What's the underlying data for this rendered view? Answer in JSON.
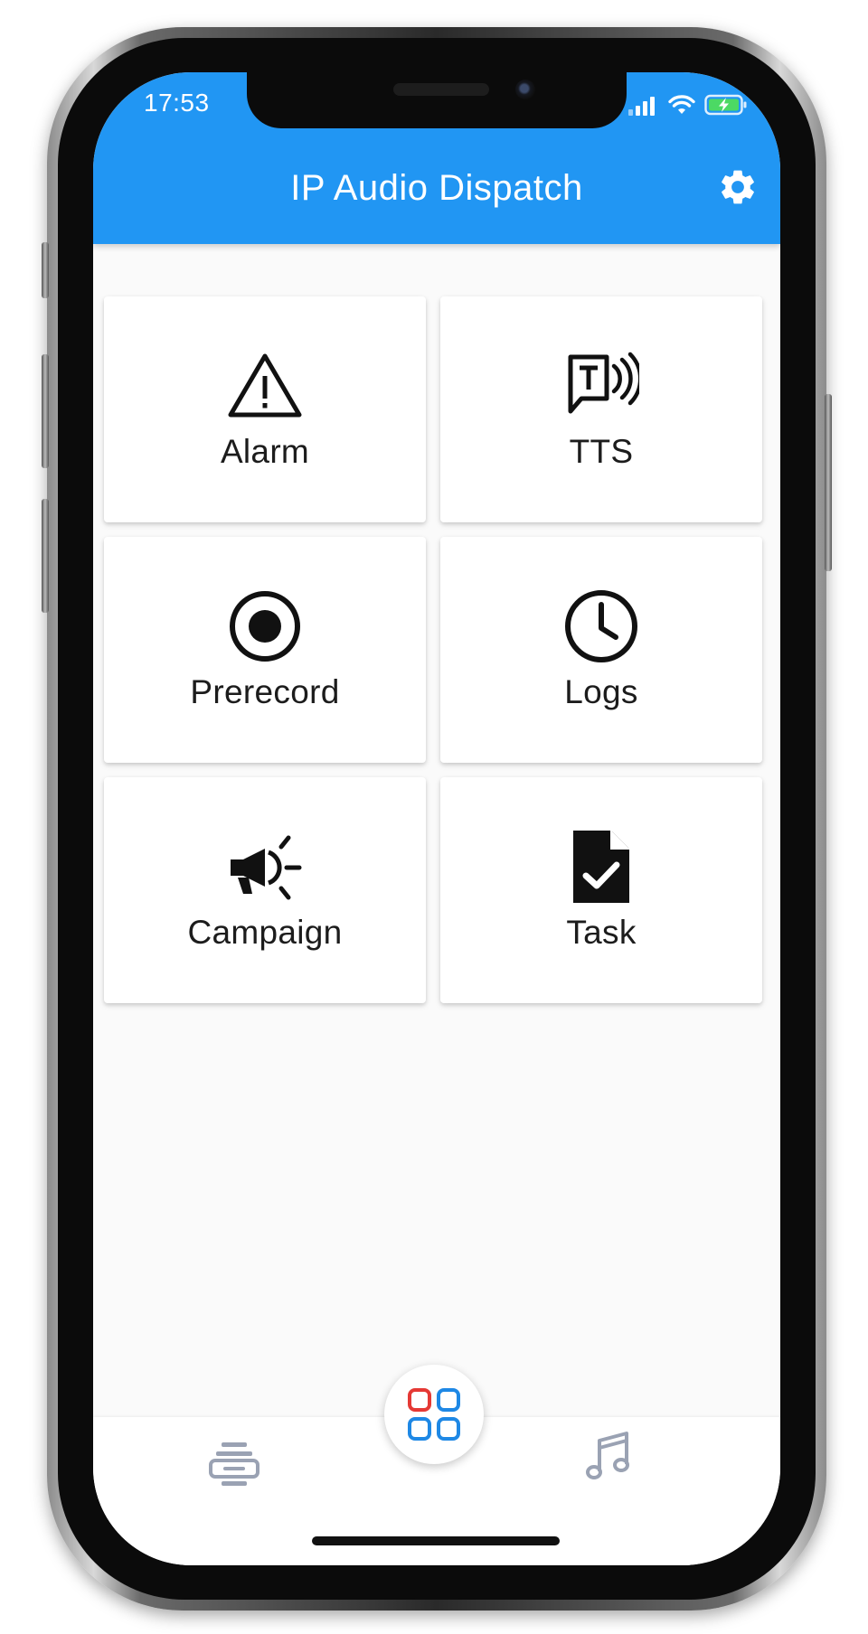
{
  "status_bar": {
    "time": "17:53"
  },
  "app_bar": {
    "title": "IP Audio Dispatch",
    "settings_icon": "gear-icon",
    "background": "#2196f3"
  },
  "tiles": [
    {
      "label": "Alarm",
      "icon": "warning-icon"
    },
    {
      "label": "TTS",
      "icon": "tts-icon"
    },
    {
      "label": "Prerecord",
      "icon": "record-icon"
    },
    {
      "label": "Logs",
      "icon": "clock-icon"
    },
    {
      "label": "Campaign",
      "icon": "megaphone-icon"
    },
    {
      "label": "Task",
      "icon": "task-icon"
    }
  ],
  "bottom_nav": {
    "left_icon": "device-icon",
    "center_icon": "apps-grid-icon",
    "right_icon": "music-note-icon"
  }
}
